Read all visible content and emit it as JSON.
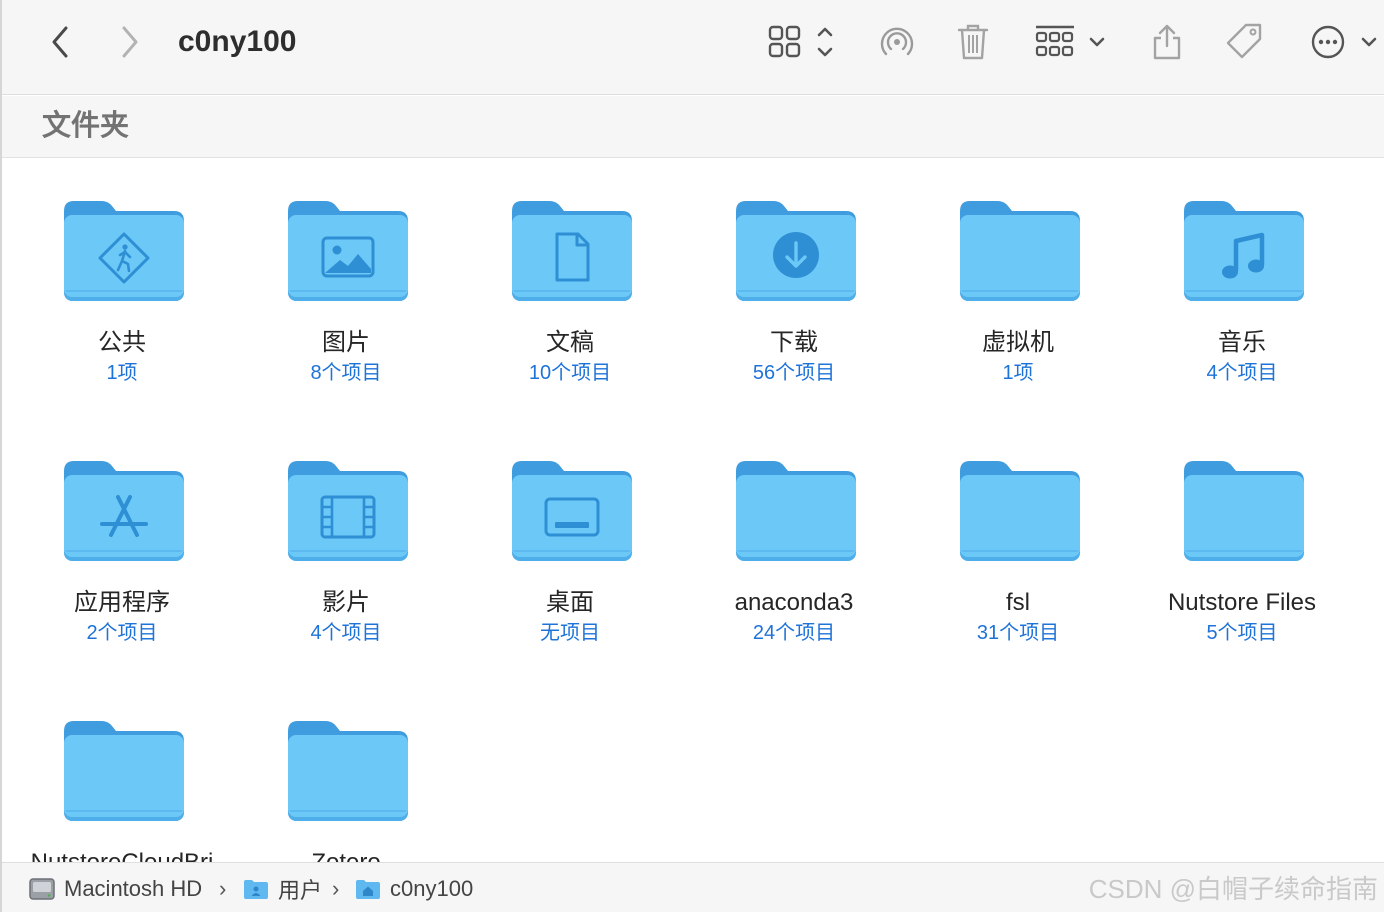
{
  "toolbar": {
    "title": "c0ny100",
    "buttons": [
      {
        "name": "back-button",
        "icon": "chevron-left-icon"
      },
      {
        "name": "forward-button",
        "icon": "chevron-right-icon"
      },
      {
        "name": "view-mode-button",
        "icon": "grid-view-icon"
      },
      {
        "name": "airdrop-button",
        "icon": "airdrop-icon"
      },
      {
        "name": "trash-button",
        "icon": "trash-icon"
      },
      {
        "name": "group-button",
        "icon": "group-grid-icon"
      },
      {
        "name": "share-button",
        "icon": "share-icon"
      },
      {
        "name": "tag-button",
        "icon": "tag-icon"
      },
      {
        "name": "more-button",
        "icon": "ellipsis-circle-icon"
      }
    ]
  },
  "section": {
    "title": "文件夹"
  },
  "folders": [
    {
      "name": "公共",
      "count": "1项",
      "glyph": "public-icon"
    },
    {
      "name": "图片",
      "count": "8个项目",
      "glyph": "photo-icon"
    },
    {
      "name": "文稿",
      "count": "10个项目",
      "glyph": "document-icon"
    },
    {
      "name": "下载",
      "count": "56个项目",
      "glyph": "download-icon"
    },
    {
      "name": "虚拟机",
      "count": "1项",
      "glyph": ""
    },
    {
      "name": "音乐",
      "count": "4个项目",
      "glyph": "music-icon"
    },
    {
      "name": "应用程序",
      "count": "2个项目",
      "glyph": "apps-icon"
    },
    {
      "name": "影片",
      "count": "4个项目",
      "glyph": "film-icon"
    },
    {
      "name": "桌面",
      "count": "无项目",
      "glyph": "desktop-icon"
    },
    {
      "name": "anaconda3",
      "count": "24个项目",
      "glyph": ""
    },
    {
      "name": "fsl",
      "count": "31个项目",
      "glyph": ""
    },
    {
      "name": "Nutstore Files",
      "count": "5个项目",
      "glyph": ""
    },
    {
      "name": "NutstoreCloudBri",
      "count": "",
      "glyph": ""
    },
    {
      "name": "Zotero",
      "count": "",
      "glyph": ""
    }
  ],
  "pathbar": {
    "items": [
      {
        "label": "Macintosh HD",
        "icon": "hard-drive-icon"
      },
      {
        "label": "用户",
        "icon": "users-folder-icon"
      },
      {
        "label": "c0ny100",
        "icon": "home-folder-icon"
      }
    ],
    "separator": "›"
  },
  "watermark": "CSDN @白帽子续命指南",
  "colors": {
    "folder_body": "#6cc8f6",
    "folder_tab": "#3f9ddf",
    "folder_glyph": "#2e8fd4",
    "count_text": "#1e73d8"
  }
}
